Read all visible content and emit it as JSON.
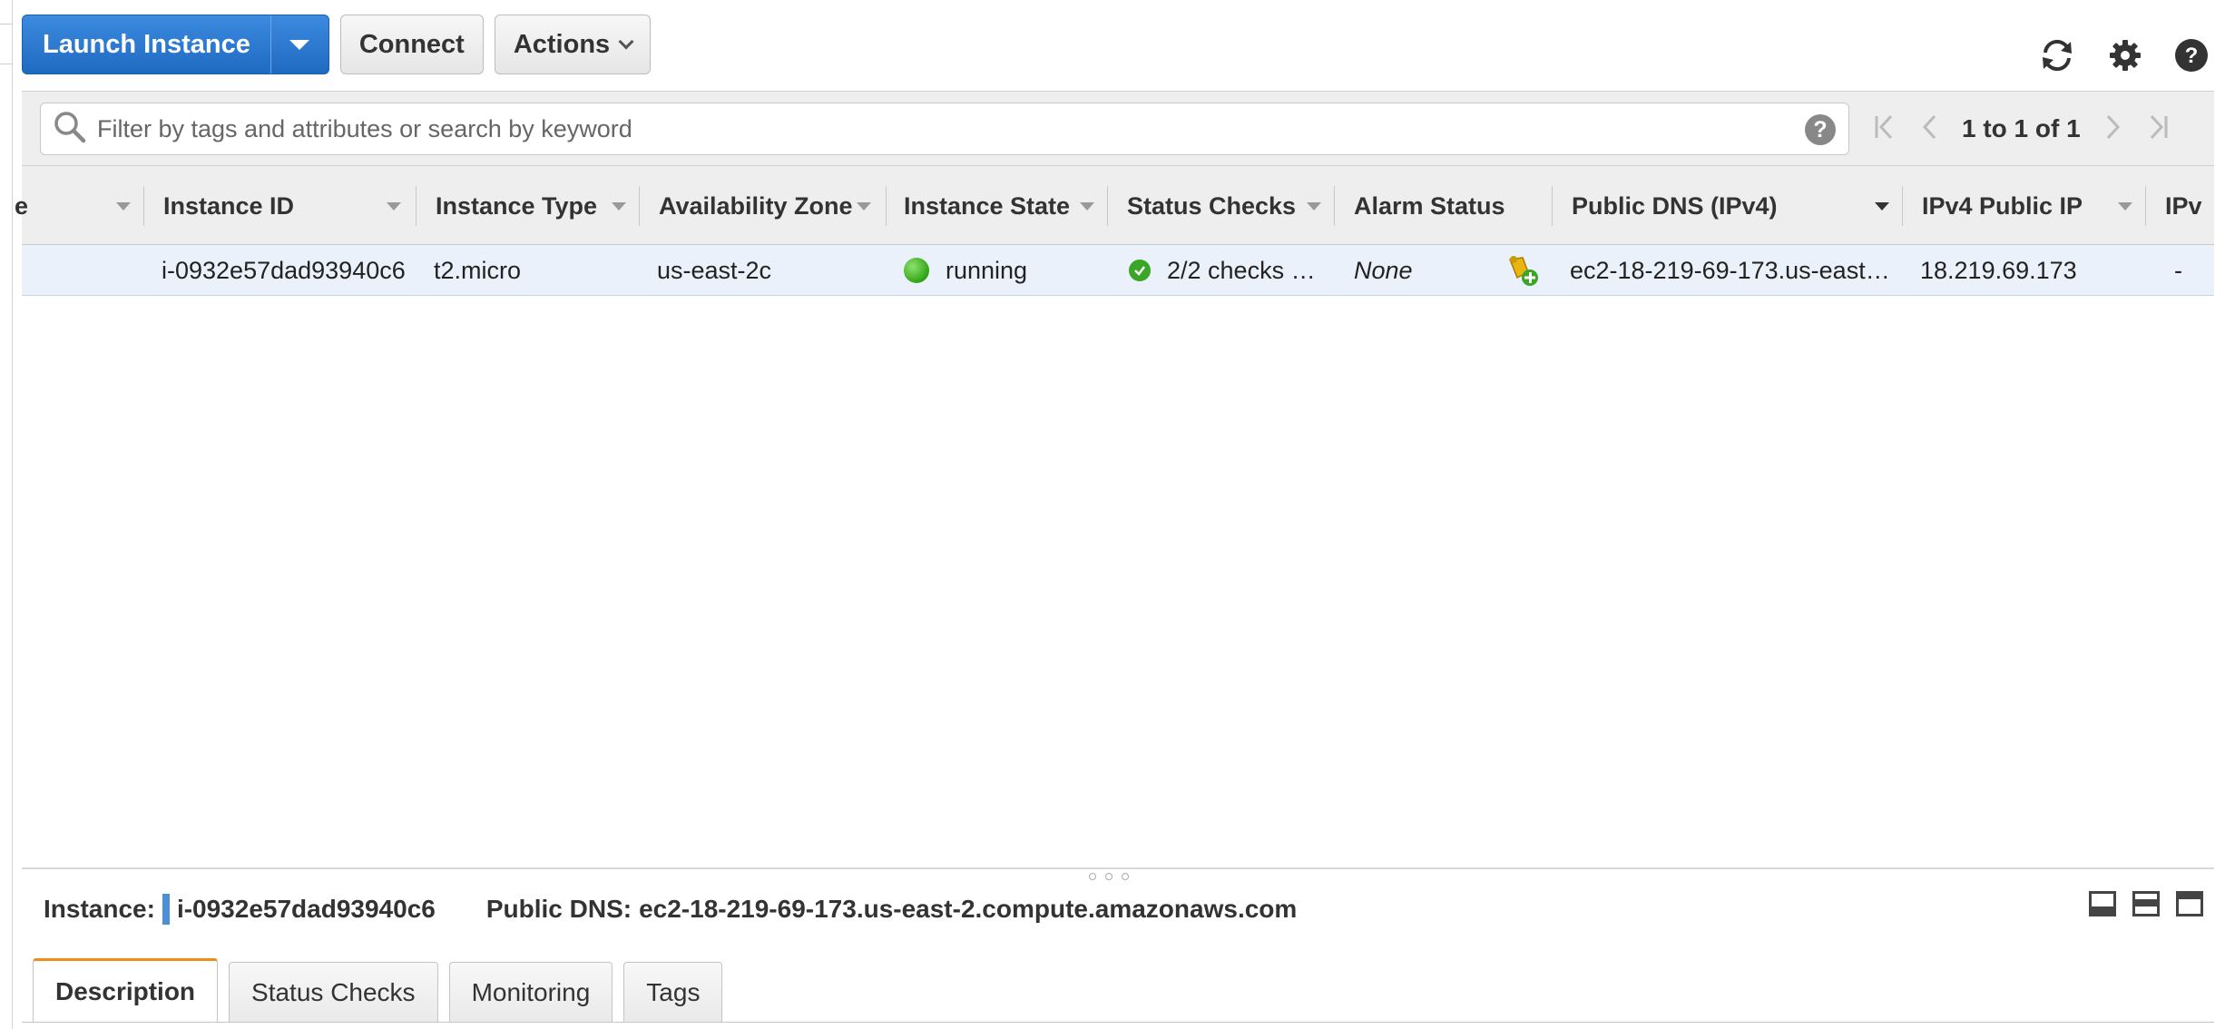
{
  "toolbar": {
    "launch_label": "Launch Instance",
    "connect_label": "Connect",
    "actions_label": "Actions"
  },
  "top_icons": [
    "refresh-icon",
    "gear-icon",
    "help-icon"
  ],
  "search": {
    "placeholder": "Filter by tags and attributes or search by keyword",
    "help": "?"
  },
  "pager": {
    "text": "1 to 1 of 1"
  },
  "table": {
    "columns": [
      "e",
      "Instance ID",
      "Instance Type",
      "Availability Zone",
      "Instance State",
      "Status Checks",
      "Alarm Status",
      "Public DNS (IPv4)",
      "IPv4 Public IP",
      "IPv"
    ],
    "rows": [
      {
        "instance_id": "i-0932e57dad93940c6",
        "instance_type": "t2.micro",
        "availability_zone": "us-east-2c",
        "instance_state": "running",
        "status_checks": "2/2 checks …",
        "alarm_status": "None",
        "public_dns": "ec2-18-219-69-173.us-east…",
        "ipv4_public_ip": "18.219.69.173",
        "ipv6": "-"
      }
    ]
  },
  "detail": {
    "instance_label": "Instance:",
    "instance_value": "i-0932e57dad93940c6",
    "dns_label": "Public DNS:",
    "dns_value": "ec2-18-219-69-173.us-east-2.compute.amazonaws.com"
  },
  "tabs": [
    "Description",
    "Status Checks",
    "Monitoring",
    "Tags"
  ],
  "colors": {
    "primary_button": "#1f6ac1",
    "row_selected": "#eaf1fb",
    "running_green": "#2ea412",
    "active_tab_accent": "#f08c1a"
  }
}
